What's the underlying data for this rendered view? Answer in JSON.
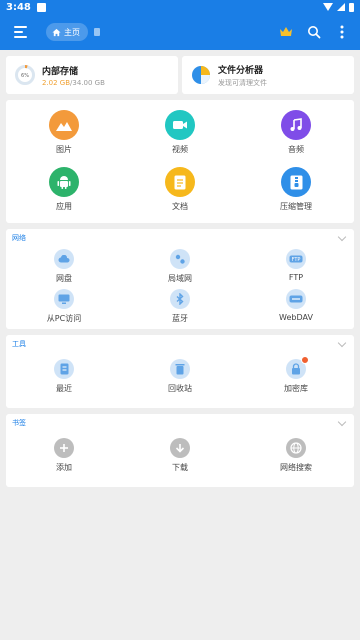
{
  "status_bar": {
    "time": "3:48"
  },
  "app_bar": {
    "home_label": "主页"
  },
  "storage": [
    {
      "title": "内部存储",
      "used": "2.02 GB",
      "total": "/34.00 GB"
    },
    {
      "title": "文件分析器",
      "subtitle": "发现可清理文件"
    }
  ],
  "main_grid": [
    {
      "label": "图片",
      "icon": "image-icon",
      "color": "#f39a3b"
    },
    {
      "label": "视频",
      "icon": "video-icon",
      "color": "#21c7c2"
    },
    {
      "label": "音频",
      "icon": "music-icon",
      "color": "#7f4de8"
    },
    {
      "label": "应用",
      "icon": "android-icon",
      "color": "#2db36b"
    },
    {
      "label": "文档",
      "icon": "document-icon",
      "color": "#f6b81c"
    },
    {
      "label": "压缩管理",
      "icon": "archive-icon",
      "color": "#2f8fe8"
    }
  ],
  "network": {
    "title": "网络",
    "items": [
      {
        "label": "网盘",
        "icon": "cloud-icon"
      },
      {
        "label": "局域网",
        "icon": "lan-icon"
      },
      {
        "label": "FTP",
        "icon": "ftp-icon"
      },
      {
        "label": "从PC访问",
        "icon": "pc-access-icon"
      },
      {
        "label": "蓝牙",
        "icon": "bluetooth-icon"
      },
      {
        "label": "WebDAV",
        "icon": "webdav-icon"
      }
    ]
  },
  "tools": {
    "title": "工具",
    "items": [
      {
        "label": "最近",
        "icon": "recent-icon"
      },
      {
        "label": "回收站",
        "icon": "recycle-bin-icon"
      },
      {
        "label": "加密库",
        "icon": "vault-icon"
      }
    ]
  },
  "bookmarks": {
    "title": "书签",
    "items": [
      {
        "label": "添加",
        "icon": "add-icon"
      },
      {
        "label": "下载",
        "icon": "download-icon"
      },
      {
        "label": "网络搜索",
        "icon": "web-search-icon"
      }
    ]
  }
}
